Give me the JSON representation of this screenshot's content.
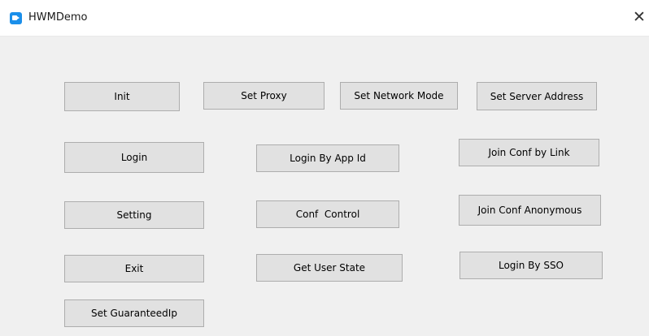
{
  "window": {
    "title": "HWMDemo",
    "close_label": "✕"
  },
  "buttons": {
    "init": "Init",
    "set_proxy": "Set Proxy",
    "set_network_mode": "Set Network Mode",
    "set_server_address": "Set Server Address",
    "login": "Login",
    "login_by_app_id": "Login By App Id",
    "join_conf_by_link": "Join Conf by Link",
    "setting": "Setting",
    "conf_control": "Conf  Control",
    "join_conf_anonymous": "Join Conf Anonymous",
    "exit": "Exit",
    "get_user_state": "Get User State",
    "login_by_sso": "Login By SSO",
    "set_guaranteed_ip": "Set GuaranteedIp"
  },
  "colors": {
    "app_icon": "#1b8fea",
    "client_background": "#f0f0f0",
    "button_face": "#e1e1e1",
    "button_border": "#adadad"
  }
}
